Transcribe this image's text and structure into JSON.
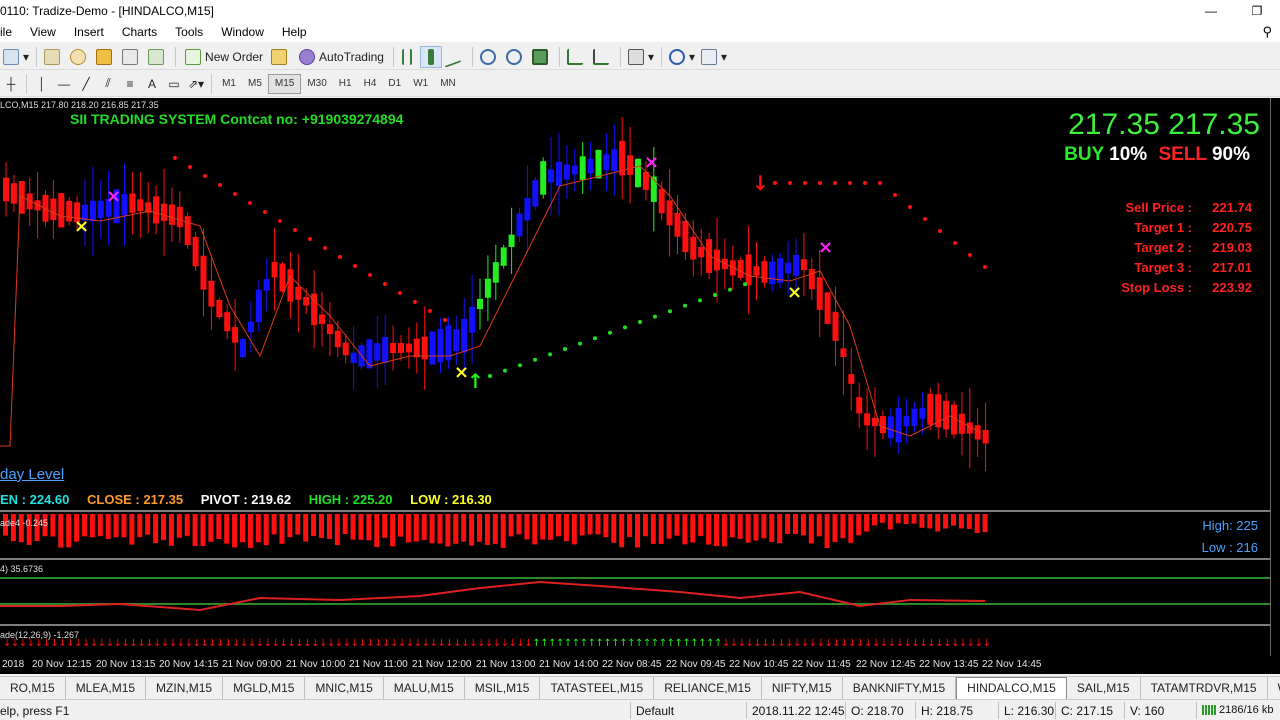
{
  "window": {
    "title": "0110: Tradize-Demo - [HINDALCO,M15]",
    "minimize": "—",
    "restore": "❐"
  },
  "menu": [
    "ile",
    "View",
    "Insert",
    "Charts",
    "Tools",
    "Window",
    "Help"
  ],
  "toolbar": {
    "new_order": "New Order",
    "auto_trading": "AutoTrading",
    "timeframes": [
      "M1",
      "M5",
      "M15",
      "M30",
      "H1",
      "H4",
      "D1",
      "W1",
      "MN"
    ],
    "active_timeframe": "M15"
  },
  "chart": {
    "symbol_line": "LCO,M15  217.80 218.20 216.85 217.35",
    "banner": "SII TRADING SYSTEM  Contcat no: +919039274894",
    "price_bid": "217.35",
    "price_ask": "217.35",
    "buy_label": "BUY",
    "buy_pct": "10%",
    "sell_label": "SELL",
    "sell_pct": "90%",
    "levels": [
      {
        "label": "Sell Price :",
        "value": "221.74"
      },
      {
        "label": "Target 1 :",
        "value": "220.75"
      },
      {
        "label": "Target 2 :",
        "value": "219.03"
      },
      {
        "label": "Target 3 :",
        "value": "217.01"
      },
      {
        "label": "Stop Loss :",
        "value": "223.92"
      }
    ],
    "day_level": "day Level",
    "open": "EN : 224.60",
    "close": "CLOSE : 217.35",
    "pivot": "PIVOT : 219.62",
    "high": "HIGH : 225.20",
    "low": "LOW : 216.30",
    "sub1_label": "ade4 -0.245",
    "sub1_high": "High: 225",
    "sub1_low": "Low : 216",
    "sub2_label": "4) 35.6736",
    "sub3_label": "ade(12,26,9) -1.267",
    "colors": {
      "bull": "#1111ff",
      "bear": "#ff1010",
      "green": "#22dd22",
      "magenta": "#ff22ff",
      "yellow": "#ffff22"
    }
  },
  "time_axis": [
    "2018",
    "20 Nov 12:15",
    "20 Nov 13:15",
    "20 Nov 14:15",
    "21 Nov 09:00",
    "21 Nov 10:00",
    "21 Nov 11:00",
    "21 Nov 12:00",
    "21 Nov 13:00",
    "21 Nov 14:00",
    "22 Nov 08:45",
    "22 Nov 09:45",
    "22 Nov 10:45",
    "22 Nov 11:45",
    "22 Nov 12:45",
    "22 Nov 13:45",
    "22 Nov 14:45"
  ],
  "tabs": [
    "RO,M15",
    "MLEA,M15",
    "MZIN,M15",
    "MGLD,M15",
    "MNIC,M15",
    "MALU,M15",
    "MSIL,M15",
    "TATASTEEL,M15",
    "RELIANCE,M15",
    "NIFTY,M15",
    "BANKNIFTY,M15",
    "HINDALCO,M15",
    "SAIL,M15",
    "TATAMTRDVR,M15",
    "WIPRO,M"
  ],
  "active_tab": "HINDALCO,M15",
  "status": {
    "help": "elp, press F1",
    "profile": "Default",
    "datetime": "2018.11.22 12:45",
    "open": "O: 218.70",
    "high": "H: 218.75",
    "low": "L: 216.30",
    "close": "C: 217.15",
    "volume": "V: 160",
    "traffic": "2186/16 kb"
  }
}
